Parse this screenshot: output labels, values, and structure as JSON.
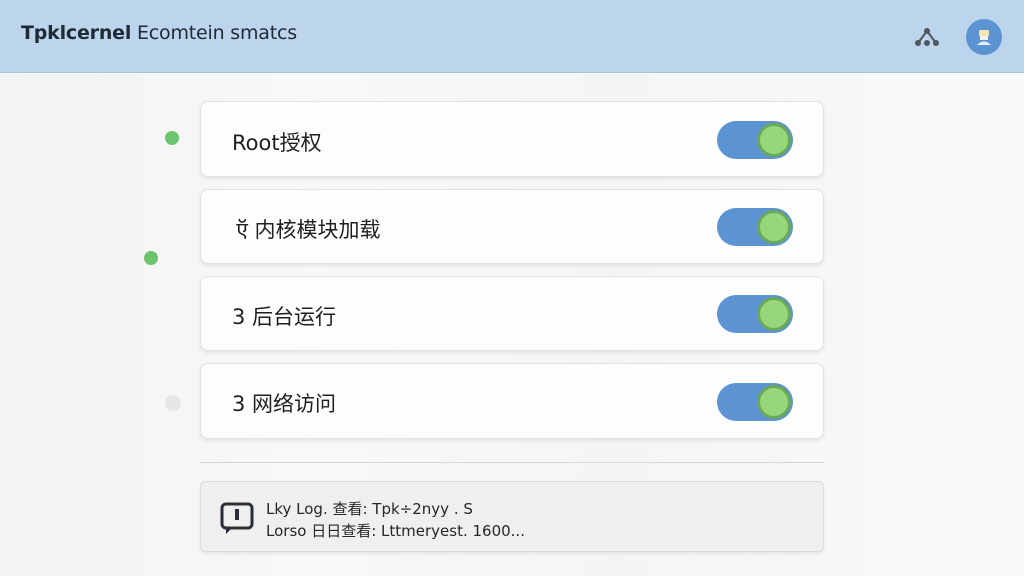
{
  "header": {
    "title_bold": "Tpklcernel",
    "title_rest": " Ecomtein smatcs",
    "share_icon": "share-nodes-icon",
    "avatar_icon": "user-avatar-icon"
  },
  "settings": [
    {
      "label": "Root授权",
      "enabled": true
    },
    {
      "label": " ऍ 内核模块加载",
      "enabled": true
    },
    {
      "label": "3 后台运行",
      "enabled": true
    },
    {
      "label": "3 网络访问",
      "enabled": true
    }
  ],
  "log": {
    "icon": "log-terminal-icon",
    "line1": "Lky Log. 查看: Tpk÷2nyy  .  S",
    "line2": "Lorso 日日查看: Lttmeryest. 1600..."
  },
  "colors": {
    "header_bg": "#bcd4ec",
    "toggle_on": "#5b93d3",
    "knob": "#97d67a",
    "status_green": "#6cc46c"
  }
}
